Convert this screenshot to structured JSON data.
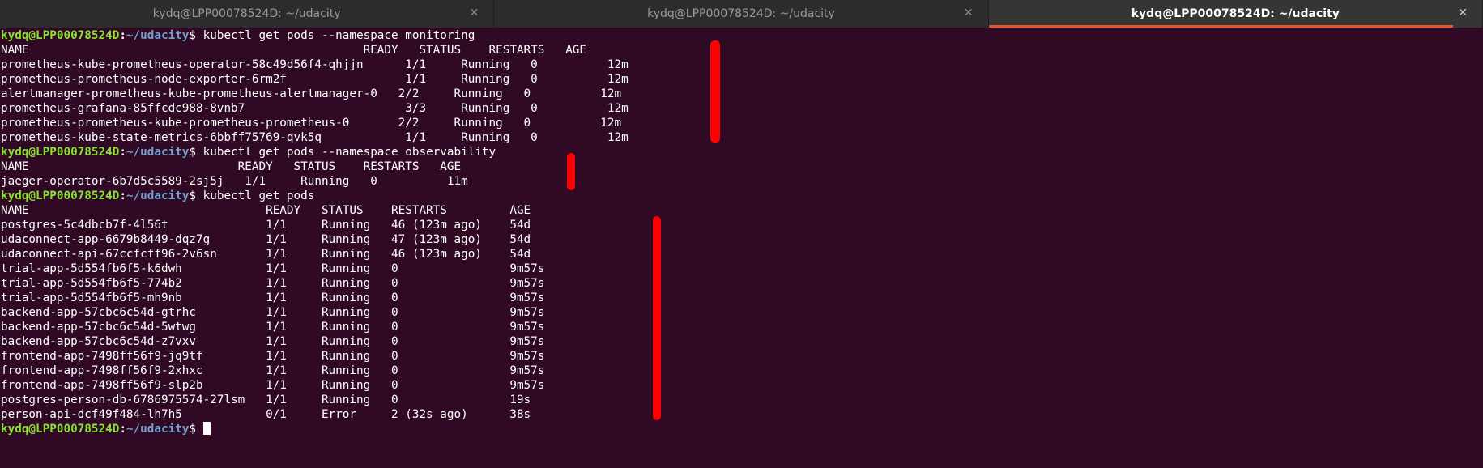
{
  "tabs": [
    {
      "title": "kydq@LPP00078524D: ~/udacity",
      "close": "✕"
    },
    {
      "title": "kydq@LPP00078524D: ~/udacity",
      "close": "✕"
    },
    {
      "title": "kydq@LPP00078524D: ~/udacity",
      "close": "✕"
    }
  ],
  "prompt": {
    "user": "kydq@LPP00078524D",
    "colon": ":",
    "path": "~/udacity",
    "symbol": "$ "
  },
  "commands": {
    "cmd1": "kubectl get pods --namespace monitoring",
    "cmd2": "kubectl get pods --namespace observability",
    "cmd3": "kubectl get pods"
  },
  "monitoring": {
    "header": "NAME                                                READY   STATUS    RESTARTS   AGE",
    "rows": [
      "prometheus-kube-prometheus-operator-58c49d56f4-qhjjn      1/1     Running   0          12m",
      "prometheus-prometheus-node-exporter-6rm2f                 1/1     Running   0          12m",
      "alertmanager-prometheus-kube-prometheus-alertmanager-0   2/2     Running   0          12m",
      "prometheus-grafana-85ffcdc988-8vnb7                       3/3     Running   0          12m",
      "prometheus-prometheus-kube-prometheus-prometheus-0       2/2     Running   0          12m",
      "prometheus-kube-state-metrics-6bbff75769-qvk5q            1/1     Running   0          12m"
    ]
  },
  "observability": {
    "header": "NAME                              READY   STATUS    RESTARTS   AGE",
    "rows": [
      "jaeger-operator-6b7d5c5589-2sj5j   1/1     Running   0          11m"
    ]
  },
  "default": {
    "header": "NAME                                  READY   STATUS    RESTARTS         AGE",
    "rows": [
      "postgres-5c4dbcb7f-4l56t              1/1     Running   46 (123m ago)    54d",
      "udaconnect-app-6679b8449-dqz7g        1/1     Running   47 (123m ago)    54d",
      "udaconnect-api-67ccfcff96-2v6sn       1/1     Running   46 (123m ago)    54d",
      "trial-app-5d554fb6f5-k6dwh            1/1     Running   0                9m57s",
      "trial-app-5d554fb6f5-774b2            1/1     Running   0                9m57s",
      "trial-app-5d554fb6f5-mh9nb            1/1     Running   0                9m57s",
      "backend-app-57cbc6c54d-gtrhc          1/1     Running   0                9m57s",
      "backend-app-57cbc6c54d-5wtwg          1/1     Running   0                9m57s",
      "backend-app-57cbc6c54d-z7vxv          1/1     Running   0                9m57s",
      "frontend-app-7498ff56f9-jq9tf         1/1     Running   0                9m57s",
      "frontend-app-7498ff56f9-2xhxc         1/1     Running   0                9m57s",
      "frontend-app-7498ff56f9-slp2b         1/1     Running   0                9m57s",
      "postgres-person-db-6786975574-27lsm   1/1     Running   0                19s",
      "person-api-dcf49f484-lh7h5            0/1     Error     2 (32s ago)      38s"
    ]
  },
  "annotation_color": "#ff0000"
}
